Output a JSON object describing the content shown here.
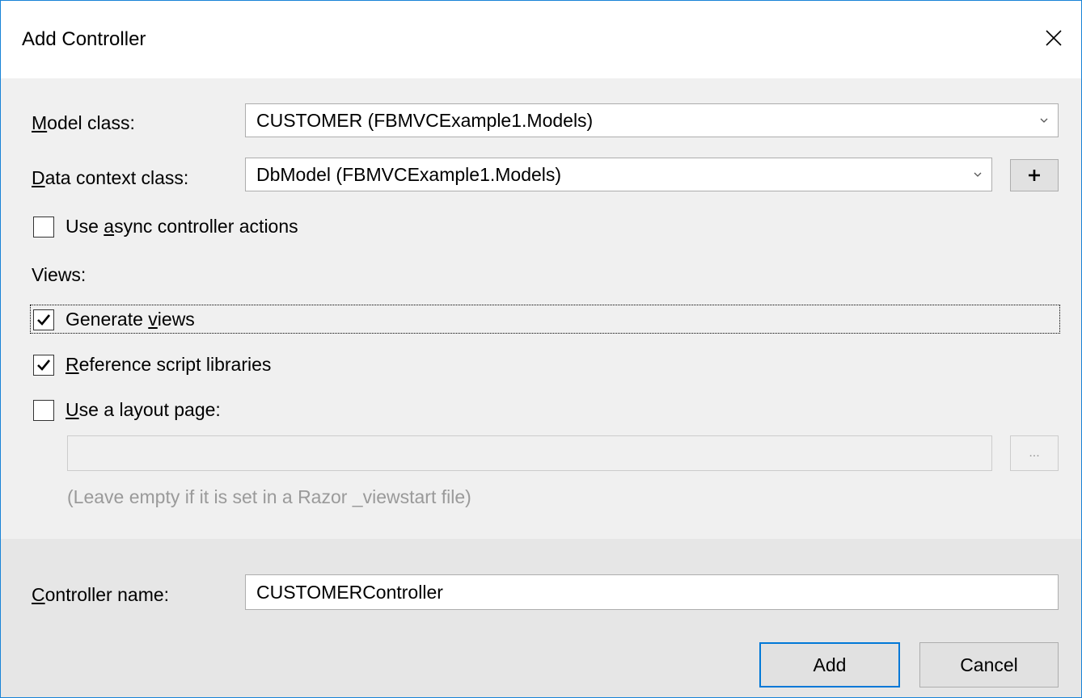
{
  "dialog": {
    "title": "Add Controller"
  },
  "model_class": {
    "label_accel": "M",
    "label_rest": "odel class:",
    "value": "CUSTOMER (FBMVCExample1.Models)"
  },
  "data_context": {
    "label_accel": "D",
    "label_rest": "ata context class:",
    "value": "DbModel (FBMVCExample1.Models)",
    "add_button": "+"
  },
  "async_actions": {
    "label_pre": "Use ",
    "label_accel": "a",
    "label_post": "sync controller actions",
    "checked": false
  },
  "views": {
    "heading": "Views:",
    "generate_views": {
      "label_pre": "Generate ",
      "label_accel": "v",
      "label_post": "iews",
      "checked": true
    },
    "reference_scripts": {
      "label_accel": "R",
      "label_post": "eference script libraries",
      "checked": true
    },
    "layout_page": {
      "label_accel": "U",
      "label_post": "se a layout page:",
      "checked": false,
      "value": "",
      "browse_button": "...",
      "hint": "(Leave empty if it is set in a Razor _viewstart file)"
    }
  },
  "controller_name": {
    "label_accel": "C",
    "label_rest": "ontroller name:",
    "value": "CUSTOMERController"
  },
  "buttons": {
    "add": "Add",
    "cancel": "Cancel"
  }
}
